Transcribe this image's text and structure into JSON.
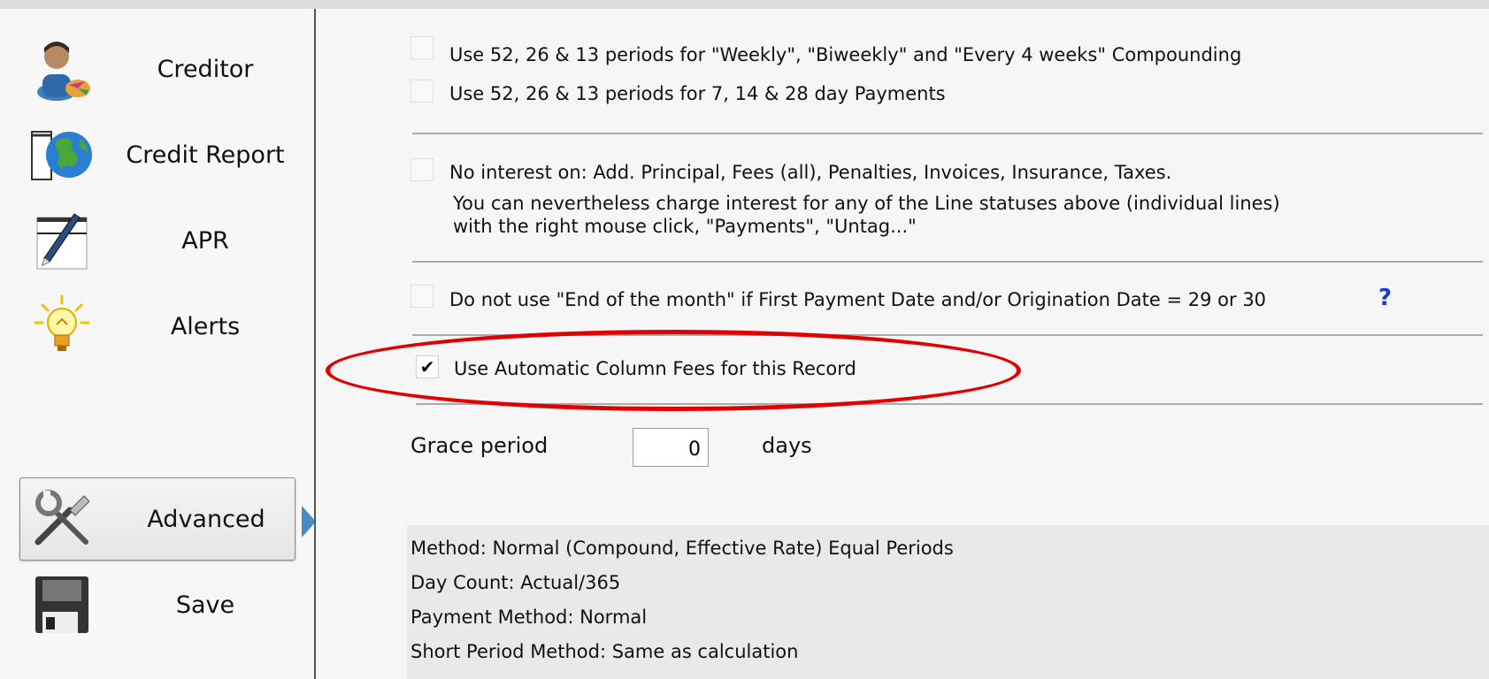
{
  "sidebar": {
    "items": [
      {
        "label": "Creditor",
        "icon": "creditor-icon"
      },
      {
        "label": "Credit Report",
        "icon": "globe-icon"
      },
      {
        "label": "APR",
        "icon": "pen-icon"
      },
      {
        "label": "Alerts",
        "icon": "lightbulb-icon"
      },
      {
        "label": "Advanced",
        "icon": "tools-icon",
        "active": true
      },
      {
        "label": "Save",
        "icon": "floppy-disk-icon"
      }
    ]
  },
  "options": {
    "periods_compounding": {
      "label": "Use 52, 26 & 13 periods for \"Weekly\", \"Biweekly\" and \"Every 4 weeks\" Compounding",
      "checked": false
    },
    "periods_payments": {
      "label": "Use 52, 26 & 13 periods for 7, 14 & 28 day Payments",
      "checked": false
    },
    "no_interest": {
      "label": "No interest on: Add. Principal, Fees (all), Penalties, Invoices, Insurance, Taxes.",
      "note_line1": "You can nevertheless charge interest for any of the Line statuses above (individual lines)",
      "note_line2": "with the right mouse click, \"Payments\", \"Untag...\"",
      "checked": false
    },
    "end_of_month": {
      "label": "Do not use \"End of the month\" if First Payment Date and/or Origination Date = 29 or 30",
      "checked": false,
      "help": "?"
    },
    "auto_column_fees": {
      "label": "Use Automatic Column Fees for this Record",
      "checked": true,
      "checkmark": "✔"
    }
  },
  "grace": {
    "label": "Grace period",
    "value": "0",
    "unit": "days"
  },
  "summary": {
    "method": "Method: Normal (Compound, Effective Rate) Equal Periods",
    "day_count": "Day Count: Actual/365",
    "payment_method": "Payment Method: Normal",
    "short_period": "Short Period Method: Same as calculation"
  },
  "colors": {
    "highlight": "#e00000",
    "help": "#1a3ccc",
    "arrow": "#4a8ac4"
  }
}
